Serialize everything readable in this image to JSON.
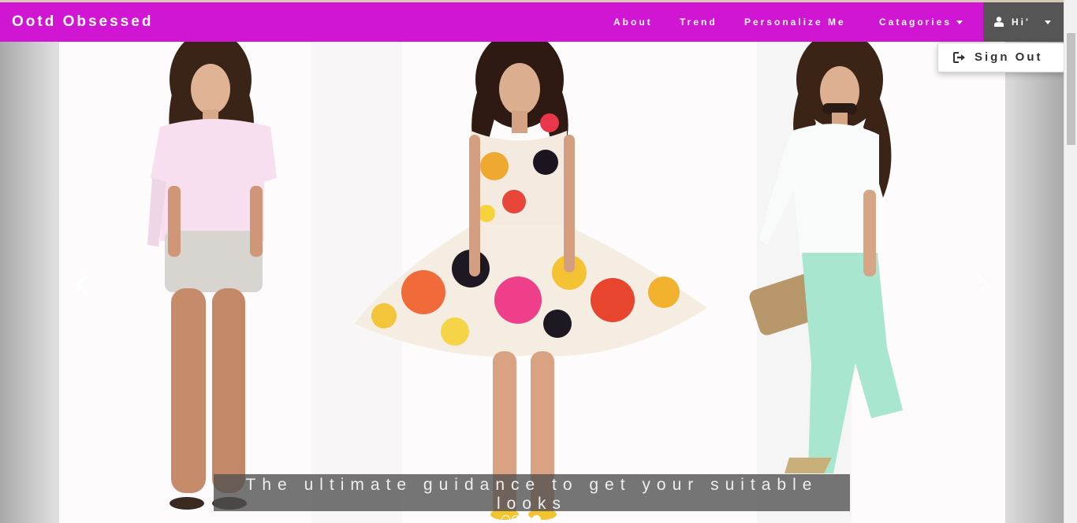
{
  "navbar": {
    "brand": "Ootd Obsessed",
    "bg_color": "#d015d3",
    "links": [
      {
        "label": "About"
      },
      {
        "label": "Trend"
      },
      {
        "label": "Personalize Me"
      },
      {
        "label": "Catagories",
        "has_caret": true
      }
    ],
    "user_menu": {
      "label": "Hi'",
      "icon": "user-icon",
      "has_caret": true,
      "bg_color": "#555555"
    }
  },
  "dropdown": {
    "items": [
      {
        "label": "Sign Out",
        "icon": "sign-out-icon"
      }
    ]
  },
  "carousel": {
    "caption": "The ultimate guidance to get your suitable looks",
    "prev_icon": "chevron-left-icon",
    "next_icon": "chevron-right-icon",
    "slide_count": 4,
    "active_slide": 3
  }
}
